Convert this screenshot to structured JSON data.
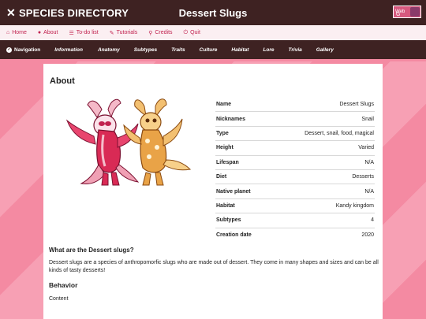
{
  "header": {
    "brand": "SPECIES DIRECTORY",
    "brand_icon": "x-logo-icon",
    "title": "Dessert Slugs",
    "badge_text": "Web",
    "badge_letter": "G"
  },
  "nav": {
    "items": [
      {
        "label": "Home",
        "icon": "home-icon"
      },
      {
        "label": "About",
        "icon": "info-icon"
      },
      {
        "label": "To-do list",
        "icon": "list-icon"
      },
      {
        "label": "Tutorials",
        "icon": "wand-icon"
      },
      {
        "label": "Credits",
        "icon": "search-icon"
      },
      {
        "label": "Quit",
        "icon": "power-icon"
      }
    ]
  },
  "tabs": {
    "navigation_label": "Navigation",
    "items": [
      "Information",
      "Anatomy",
      "Subtypes",
      "Traits",
      "Culture",
      "Habitat",
      "Lore",
      "Trivia",
      "Gallery"
    ]
  },
  "about": {
    "title": "About",
    "rows": [
      {
        "key": "Name",
        "value": "Dessert Slugs"
      },
      {
        "key": "Nicknames",
        "value": "Snail"
      },
      {
        "key": "Type",
        "value": "Dessert, snail, food, magical"
      },
      {
        "key": "Height",
        "value": "Varied"
      },
      {
        "key": "Lifespan",
        "value": "N/A"
      },
      {
        "key": "Diet",
        "value": "Desserts"
      },
      {
        "key": "Native planet",
        "value": "N/A"
      },
      {
        "key": "Habitat",
        "value": "Kandy kingdom"
      },
      {
        "key": "Subtypes",
        "value": "4"
      },
      {
        "key": "Creation date",
        "value": "2020"
      }
    ]
  },
  "section": {
    "question": "What are the Dessert slugs?",
    "description": "Dessert slugs are a species of anthropomorfic slugs who are made out of dessert. They come in many shapes and sizes and can be all kinds of tasty desserts!",
    "behavior_title": "Behavior",
    "behavior_text": "Content"
  },
  "colors": {
    "header_bg": "#3e2222",
    "accent": "#c1224f",
    "background": "#f48aa2"
  }
}
